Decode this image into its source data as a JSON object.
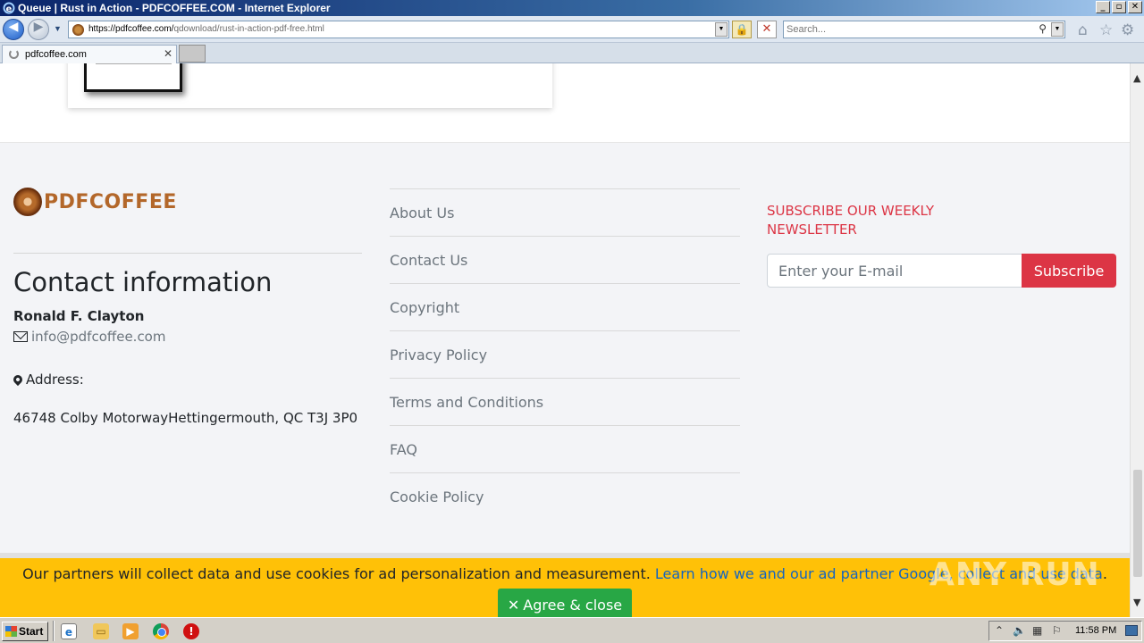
{
  "window": {
    "title": "Queue | Rust in Action - PDFCOFFEE.COM - Internet Explorer",
    "controls": {
      "minimize": "_",
      "restore": "▫",
      "close": "✕"
    }
  },
  "navbar": {
    "back_icon": "back-arrow-icon",
    "forward_icon": "forward-arrow-icon",
    "url_host": "https://pdfcoffee.com/",
    "url_path": "qdownload/rust-in-action-pdf-free.html",
    "search_placeholder": "Search...",
    "toolbar_icons": [
      "home-icon",
      "star-icon",
      "gear-icon"
    ]
  },
  "tabs": [
    {
      "label": "pdfcoffee.com",
      "loading": true
    }
  ],
  "footer": {
    "brand": "PDFCOFFEE",
    "contact_title": "Contact information",
    "contact_name": "Ronald F. Clayton",
    "contact_email": "info@pdfcoffee.com",
    "address_label": "Address:",
    "address": "46748 Colby MotorwayHettingermouth, QC T3J 3P0",
    "links": [
      "About Us",
      "Contact Us",
      "Copyright",
      "Privacy Policy",
      "Terms and Conditions",
      "FAQ",
      "Cookie Policy"
    ],
    "newsletter_title": "SUBSCRIBE OUR WEEKLY NEWSLETTER",
    "email_placeholder": "Enter your E-mail",
    "subscribe_label": "Subscribe"
  },
  "cookie": {
    "text": "Our partners will collect data and use cookies for ad personalization and measurement.",
    "link_text": "Learn how we and our ad partner Google, collect and use data",
    "agree_label": "Agree & close"
  },
  "watermark": "ANY RUN",
  "taskbar": {
    "start_label": "Start",
    "clock": "11:58 PM"
  },
  "colors": {
    "accent_red": "#dc3545",
    "cookie_yellow": "#ffc107",
    "agree_green": "#28a745",
    "brand_brown": "#b3672a"
  }
}
